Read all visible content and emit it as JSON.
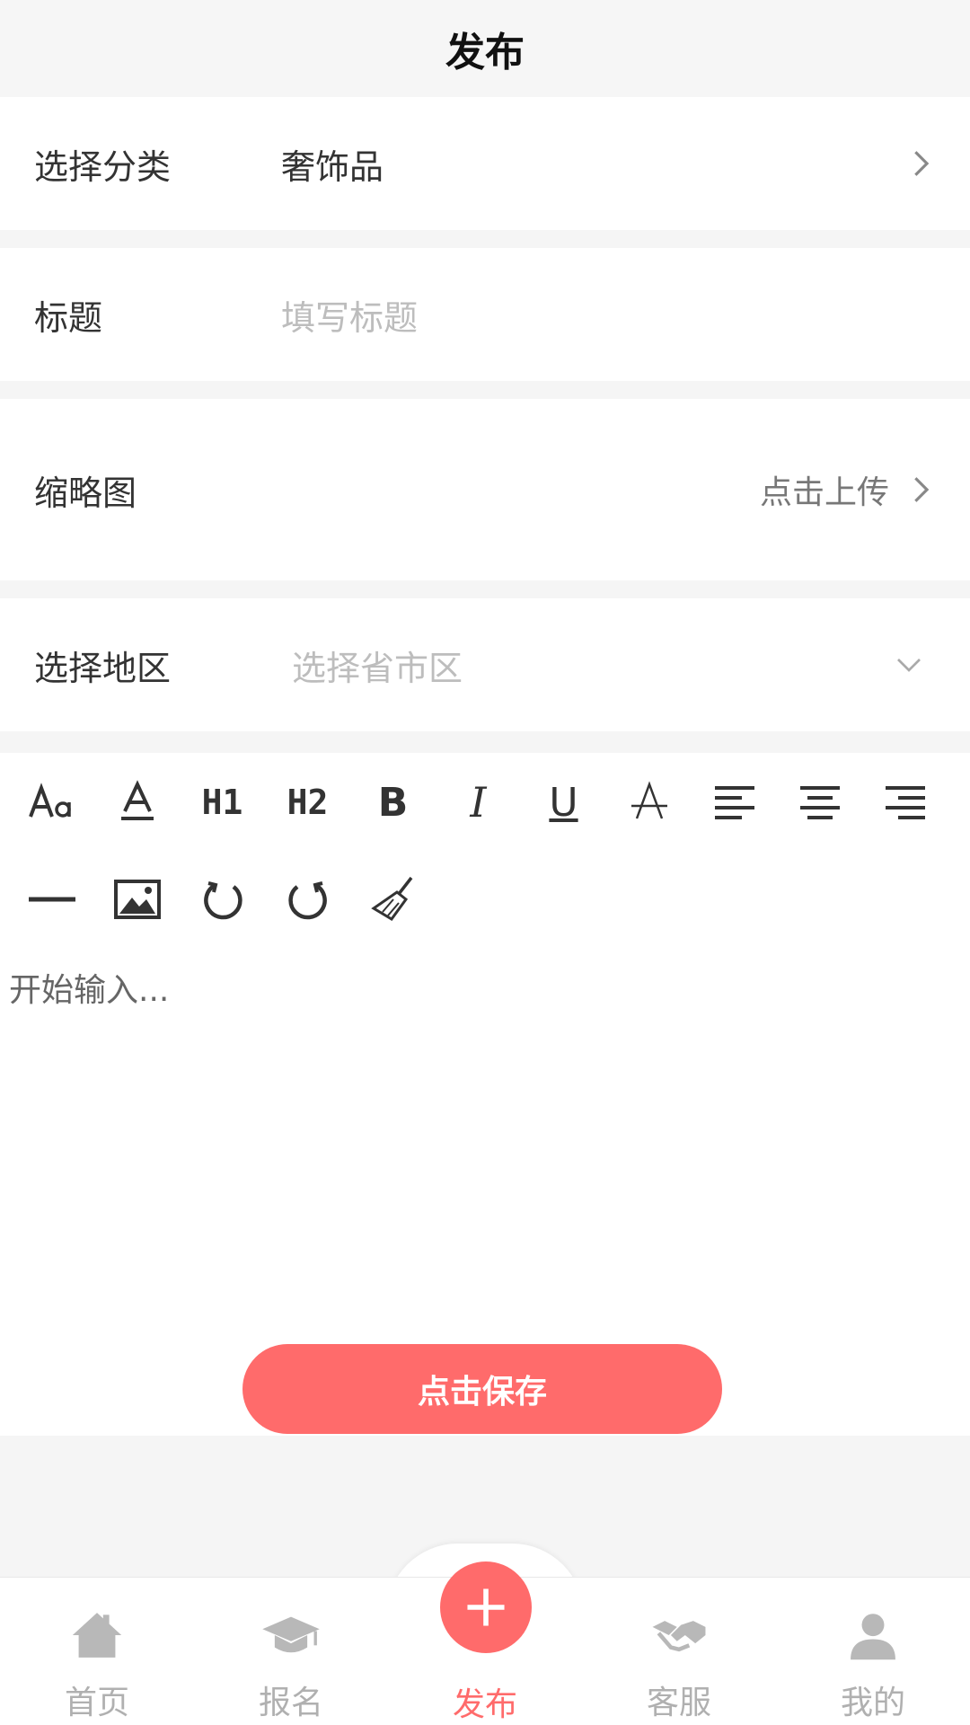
{
  "header": {
    "title": "发布"
  },
  "form": {
    "category": {
      "label": "选择分类",
      "value": "奢饰品"
    },
    "title": {
      "label": "标题",
      "placeholder": "填写标题"
    },
    "thumbnail": {
      "label": "缩略图",
      "action": "点击上传"
    },
    "region": {
      "label": "选择地区",
      "placeholder": "选择省市区"
    }
  },
  "toolbar": {
    "h1": "H1",
    "h2": "H2",
    "bold": "B",
    "italic": "I",
    "underline": "U"
  },
  "editor": {
    "placeholder": "开始输入..."
  },
  "save_label": "点击保存",
  "tabs": [
    {
      "label": "首页",
      "icon": "home-icon"
    },
    {
      "label": "报名",
      "icon": "graduation-cap-icon"
    },
    {
      "label": "发布",
      "icon": "plus-icon"
    },
    {
      "label": "客服",
      "icon": "handshake-icon"
    },
    {
      "label": "我的",
      "icon": "user-icon"
    }
  ],
  "colors": {
    "accent": "#ff6b6b",
    "inactive_tab": "#b0b0b0",
    "placeholder": "#bdbdbd"
  }
}
